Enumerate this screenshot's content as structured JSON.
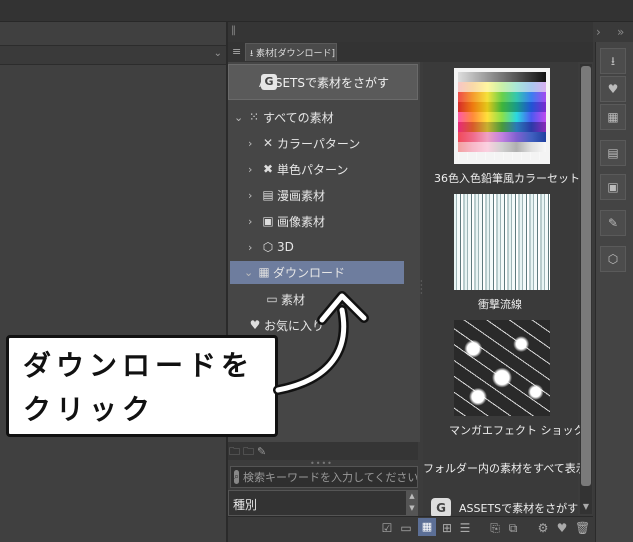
{
  "panel": {
    "tab_label": "素材[ダウンロード]",
    "assets_button_label": "ASSETSで素材をさがす"
  },
  "tree": {
    "root_label": "すべての素材",
    "items": [
      {
        "label": "カラーパターン",
        "icon": "color-pattern-icon"
      },
      {
        "label": "単色パターン",
        "icon": "mono-pattern-icon"
      },
      {
        "label": "漫画素材",
        "icon": "manga-material-icon"
      },
      {
        "label": "画像素材",
        "icon": "image-material-icon"
      },
      {
        "label": "3D",
        "icon": "cube-icon"
      },
      {
        "label": "ダウンロード",
        "icon": "download-folder-icon",
        "selected": true
      }
    ],
    "sub_item_label": "素材",
    "favorites_label": "お気に入り"
  },
  "items": [
    {
      "label": "36色入色鉛筆風カラーセット"
    },
    {
      "label": "衝撃流線"
    },
    {
      "label": "マンガエフェクト ショック"
    }
  ],
  "show_all_label": "フォルダー内の素材をすべて表示",
  "assets_bottom_label": "ASSETSで素材をさがす",
  "search": {
    "placeholder": "検索キーワードを入力してください。"
  },
  "type_select": {
    "value": "種別"
  },
  "callout": {
    "text": "ダウンロードを\nクリック"
  },
  "colors": {
    "selection": "#6e7d9e",
    "panel": "#3c3c3c"
  }
}
